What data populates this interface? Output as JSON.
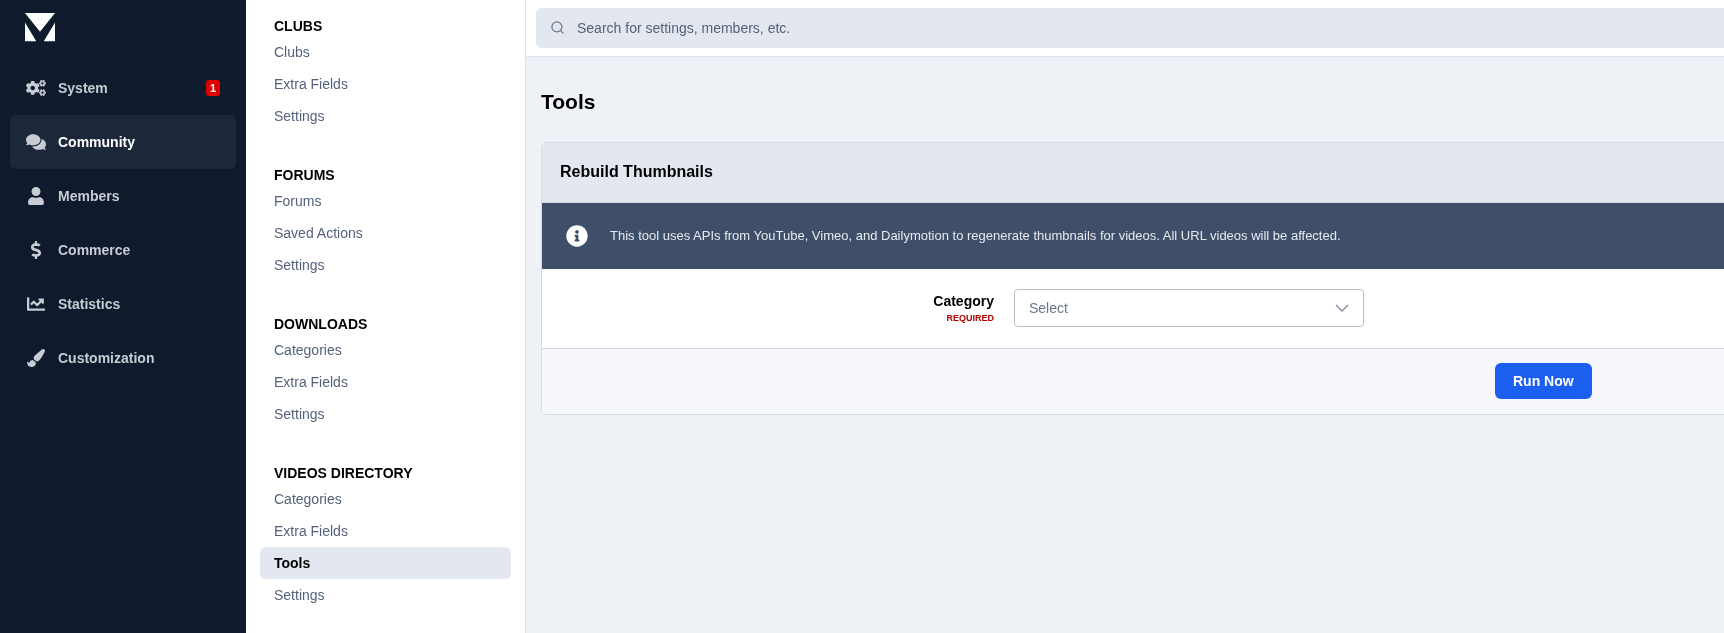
{
  "sidebar": {
    "items": [
      {
        "kind": "system",
        "label": "System",
        "badge": "1",
        "selected": false
      },
      {
        "kind": "community",
        "label": "Community",
        "selected": true
      },
      {
        "kind": "members",
        "label": "Members",
        "selected": false
      },
      {
        "kind": "commerce",
        "label": "Commerce",
        "selected": false
      },
      {
        "kind": "statistics",
        "label": "Statistics",
        "selected": false
      },
      {
        "kind": "customization",
        "label": "Customization",
        "selected": false
      }
    ]
  },
  "subnav": {
    "groups": [
      {
        "heading": "CLUBS",
        "items": [
          {
            "label": "Clubs",
            "selected": false
          },
          {
            "label": "Extra Fields",
            "selected": false
          },
          {
            "label": "Settings",
            "selected": false
          }
        ]
      },
      {
        "heading": "FORUMS",
        "items": [
          {
            "label": "Forums",
            "selected": false
          },
          {
            "label": "Saved Actions",
            "selected": false
          },
          {
            "label": "Settings",
            "selected": false
          }
        ]
      },
      {
        "heading": "DOWNLOADS",
        "items": [
          {
            "label": "Categories",
            "selected": false
          },
          {
            "label": "Extra Fields",
            "selected": false
          },
          {
            "label": "Settings",
            "selected": false
          }
        ]
      },
      {
        "heading": "VIDEOS DIRECTORY",
        "items": [
          {
            "label": "Categories",
            "selected": false
          },
          {
            "label": "Extra Fields",
            "selected": false
          },
          {
            "label": "Tools",
            "selected": true
          },
          {
            "label": "Settings",
            "selected": false
          }
        ]
      }
    ]
  },
  "search": {
    "placeholder": "Search for settings, members, etc."
  },
  "page_title": "Tools",
  "card": {
    "title": "Rebuild Thumbnails",
    "info": "This tool uses APIs from YouTube, Vimeo, and Dailymotion to regenerate thumbnails for videos. All URL videos will be affected.",
    "field": {
      "label": "Category",
      "required": "REQUIRED",
      "placeholder": "Select"
    },
    "button": "Run Now"
  }
}
